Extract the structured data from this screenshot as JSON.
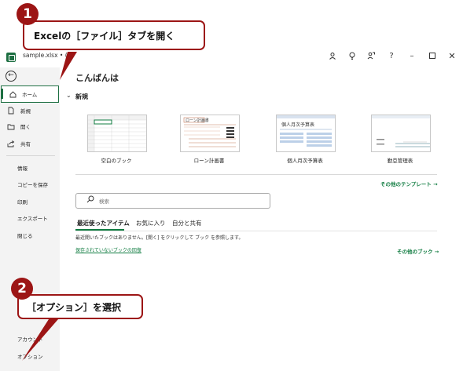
{
  "titlebar": {
    "filename": "sample.xlsx • ("
  },
  "sidebar": {
    "items": [
      {
        "label": "ホーム",
        "icon": "home-icon"
      },
      {
        "label": "新規",
        "icon": "new-file-icon"
      },
      {
        "label": "開く",
        "icon": "open-folder-icon"
      },
      {
        "label": "共有",
        "icon": "share-icon"
      }
    ],
    "text_items": [
      "情報",
      "コピーを保存",
      "印刷",
      "エクスポート",
      "閉じる"
    ],
    "bottom_items": [
      "アカウント",
      "オプション"
    ]
  },
  "main": {
    "greeting": "こんばんは",
    "new_section": "新規",
    "templates": [
      {
        "label": "空白のブック"
      },
      {
        "label": "ローン計画書",
        "header": "ローン計画書"
      },
      {
        "label": "個人月次予算表",
        "header": "個人月次予算表"
      },
      {
        "label": "勤怠管理表"
      }
    ],
    "more_templates": "その他のテンプレート →",
    "search_placeholder": "検索",
    "tabs": [
      "最近使ったアイテム",
      "お気に入り",
      "自分と共有"
    ],
    "empty_message": "最近開いたブックはありません。[開く] をクリックして ブック を参照します。",
    "unsaved_link": "保存されていないブックの回復",
    "more_books": "その他のブック →"
  },
  "callouts": {
    "step1_num": "1",
    "step1_text": "Excelの［ファイル］タブを開く",
    "step2_num": "2",
    "step2_text": "［オプション］を選択"
  },
  "colors": {
    "excel_green": "#107c41",
    "callout_red": "#9c1515"
  }
}
